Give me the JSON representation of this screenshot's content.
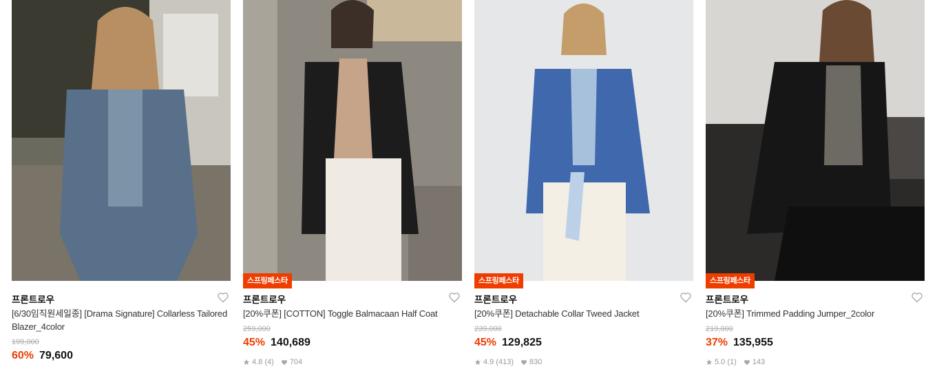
{
  "products": [
    {
      "badge": "",
      "brand": "프론트로우",
      "title": "[6/30임직원세일종] [Drama Signature] Collarless Tailored Blazer_4color",
      "original_price": "199,000",
      "discount": "60%",
      "price": "79,600",
      "rating": "",
      "reviews": "",
      "likes": "",
      "image_tone": "#4f6477"
    },
    {
      "badge": "스프링페스타",
      "brand": "프론트로우",
      "title": "[20%쿠폰] [COTTON] Toggle Balmacaan Half Coat",
      "original_price": "259,000",
      "discount": "45%",
      "price": "140,689",
      "rating": "4.8",
      "reviews": "(4)",
      "likes": "704",
      "image_tone": "#8a8378"
    },
    {
      "badge": "스프링페스타",
      "brand": "프론트로우",
      "title": "[20%쿠폰] Detachable Collar Tweed Jacket",
      "original_price": "239,000",
      "discount": "45%",
      "price": "129,825",
      "rating": "4.9",
      "reviews": "(413)",
      "likes": "830",
      "image_tone": "#e7e8ea"
    },
    {
      "badge": "스프링페스타",
      "brand": "프론트로우",
      "title": "[20%쿠폰] Trimmed Padding Jumper_2color",
      "original_price": "219,000",
      "discount": "37%",
      "price": "135,955",
      "rating": "5.0",
      "reviews": "(1)",
      "likes": "143",
      "image_tone": "#3a3632"
    }
  ],
  "colors": {
    "accent": "#ef3d00",
    "muted": "#999999"
  },
  "icons": {
    "like": "heart-outline-icon",
    "rating": "star-icon",
    "likes": "heart-filled-icon"
  }
}
